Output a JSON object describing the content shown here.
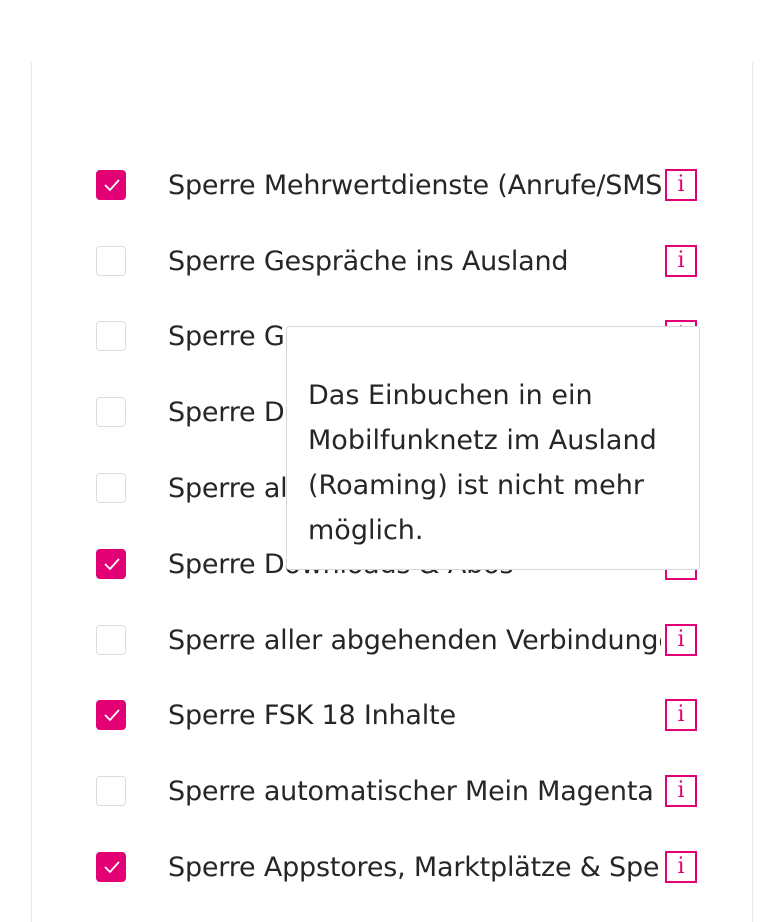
{
  "options": [
    {
      "label": "Sperre Mehrwertdienste (Anrufe/SMS)",
      "checked": true,
      "info_icon": "i"
    },
    {
      "label": "Sperre Gespräche ins Ausland",
      "checked": false,
      "info_icon": "i"
    },
    {
      "label": "Sperre Ge",
      "checked": false,
      "info_icon": "i"
    },
    {
      "label": "Sperre Da",
      "checked": false,
      "info_icon": "i"
    },
    {
      "label": "Sperre all",
      "checked": false,
      "info_icon": "i"
    },
    {
      "label": "Sperre Downloads & Abos",
      "checked": true,
      "info_icon": "i"
    },
    {
      "label": "Sperre aller abgehenden Verbindungen",
      "checked": false,
      "info_icon": "i"
    },
    {
      "label": "Sperre FSK 18 Inhalte",
      "checked": true,
      "info_icon": "i"
    },
    {
      "label": "Sperre automatischer Mein Magenta Login",
      "checked": false,
      "info_icon": "i"
    },
    {
      "label": "Sperre Appstores, Marktplätze & Spenden",
      "checked": true,
      "info_icon": "i"
    }
  ],
  "tooltip": {
    "text": "Das Einbuchen in ein Mobilfunknetz im Ausland (Roaming) ist nicht mehr möglich."
  },
  "colors": {
    "accent": "#e20074",
    "checkbox_border": "#dcdcdc",
    "text": "#262626"
  },
  "icons": {
    "checkmark": "checkmark-icon",
    "info": "info-icon"
  }
}
